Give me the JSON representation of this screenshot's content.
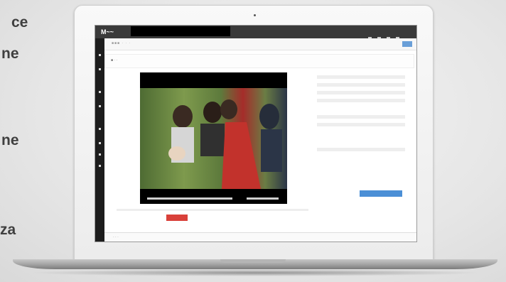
{
  "side_text": [
    "ce",
    "ne",
    "ne",
    "za"
  ],
  "screen": {
    "logo": "M~~",
    "breadcrumb": "■■■ · · ·",
    "title_row": "■ · ·",
    "footer_text": "· · ·"
  },
  "colors": {
    "accent_red": "#d9413a",
    "accent_blue": "#4b8fd6",
    "topbar": "#3a3a3a",
    "sidebar": "#1d1d1d"
  }
}
